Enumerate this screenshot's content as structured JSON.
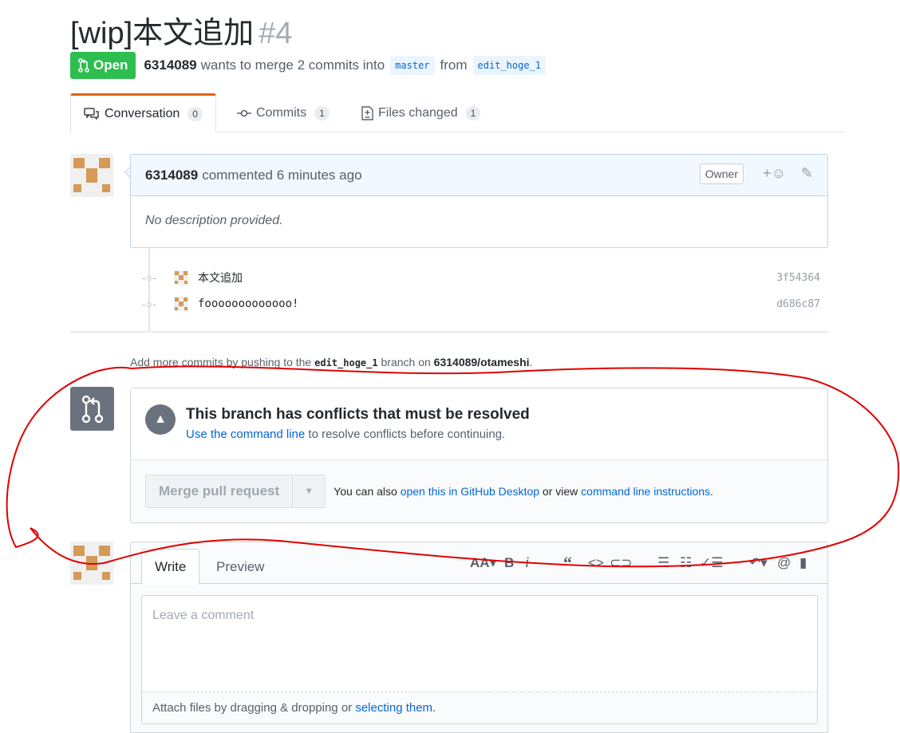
{
  "pr": {
    "title": "[wip]本文追加",
    "number": "#4",
    "state": "Open",
    "author": "6314089",
    "merge_text": "wants to merge 2 commits into",
    "base": "master",
    "from_word": "from",
    "head": "edit_hoge_1"
  },
  "tabs": [
    {
      "label": "Conversation",
      "count": "0"
    },
    {
      "label": "Commits",
      "count": "1"
    },
    {
      "label": "Files changed",
      "count": "1"
    }
  ],
  "comment": {
    "author": "6314089",
    "action": "commented 6 minutes ago",
    "badge": "Owner",
    "body": "No description provided."
  },
  "commits": [
    {
      "message": "本文追加",
      "sha": "3f54364"
    },
    {
      "message": "fooooooooooooo!",
      "sha": "d686c87"
    }
  ],
  "addmore": {
    "prefix": "Add more commits by pushing to the",
    "branch": "edit_hoge_1",
    "middle": "branch on",
    "repo": "6314089/otameshi",
    "suffix": "."
  },
  "merge": {
    "heading": "This branch has conflicts that must be resolved",
    "sub_link": "Use the command line",
    "sub_rest": "to resolve conflicts before continuing.",
    "button": "Merge pull request",
    "also_prefix": "You can also",
    "also_link1": "open this in GitHub Desktop",
    "also_mid": "or view",
    "also_link2": "command line instructions",
    "also_suffix": "."
  },
  "composer": {
    "write_tab": "Write",
    "preview_tab": "Preview",
    "placeholder": "Leave a comment",
    "attach_prefix": "Attach files by dragging & dropping or",
    "attach_link": "selecting them",
    "attach_suffix": "."
  },
  "colors": {
    "open": "#2cbe4e",
    "link": "#0366d6",
    "annotation": "#e00000"
  }
}
